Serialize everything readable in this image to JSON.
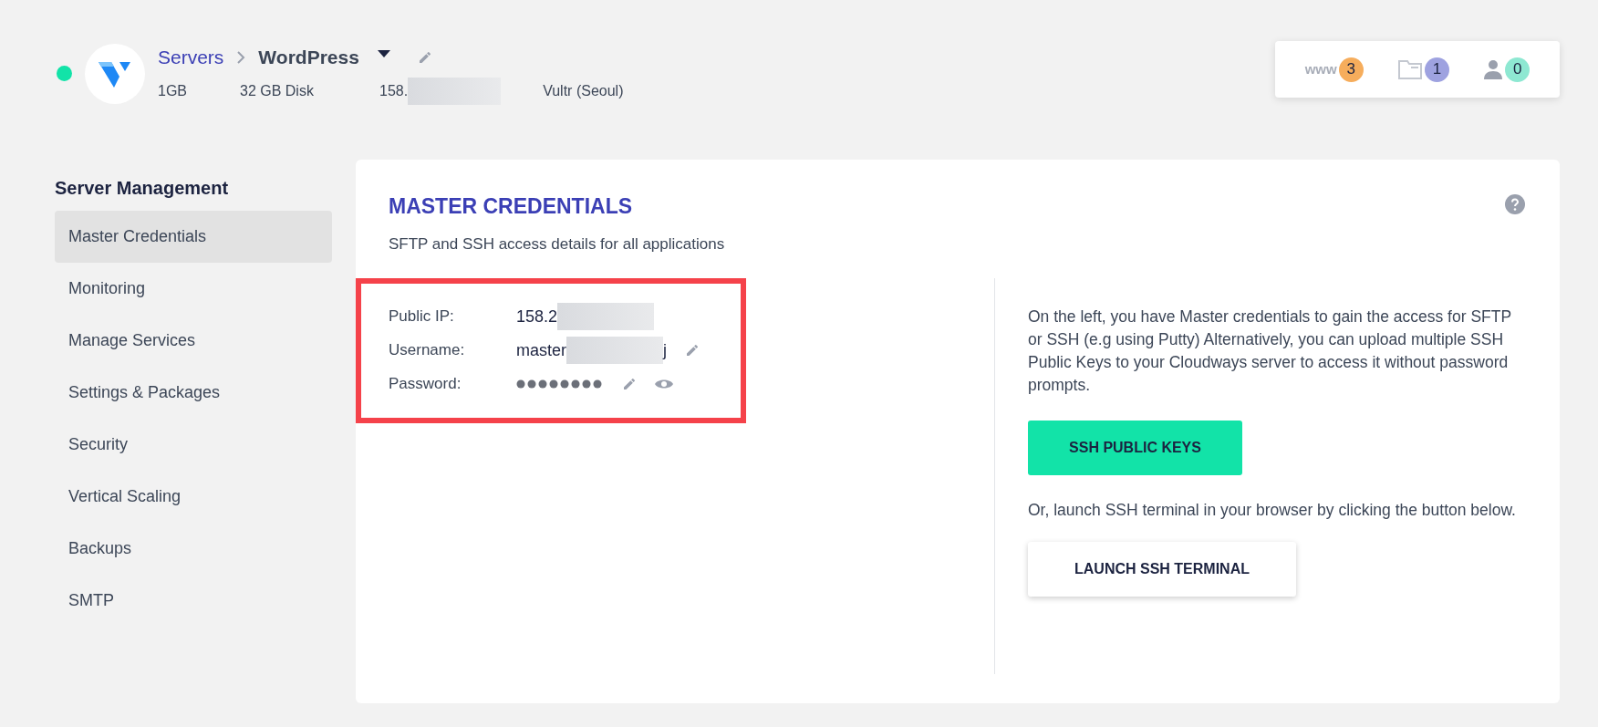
{
  "server": {
    "online": true,
    "breadcrumb": "Servers",
    "name": "WordPress",
    "ram": "1GB",
    "disk": "32 GB Disk",
    "ip_start": "158.",
    "provider": "Vultr (Seoul)"
  },
  "counters": [
    {
      "kind": "www",
      "label": "www",
      "count": "3",
      "color": "#f6ad5c"
    },
    {
      "kind": "folder",
      "count": "1",
      "color": "#9ea2e0"
    },
    {
      "kind": "user",
      "count": "0",
      "color": "#8ee8d2"
    }
  ],
  "sidebar": {
    "heading": "Server Management",
    "items": [
      {
        "label": "Master Credentials",
        "selected": true
      },
      {
        "label": "Monitoring",
        "selected": false
      },
      {
        "label": "Manage Services",
        "selected": false
      },
      {
        "label": "Settings & Packages",
        "selected": false
      },
      {
        "label": "Security",
        "selected": false
      },
      {
        "label": "Vertical Scaling",
        "selected": false
      },
      {
        "label": "Backups",
        "selected": false
      },
      {
        "label": "SMTP",
        "selected": false
      }
    ]
  },
  "panel": {
    "title": "MASTER CREDENTIALS",
    "subtitle": "SFTP and SSH access details for all applications",
    "credentials": [
      {
        "kind": "ip",
        "label": "Public IP:",
        "value_start": "158.2"
      },
      {
        "kind": "username",
        "label": "Username:",
        "value_start": "master",
        "value_end": "j",
        "actions": [
          {
            "kind": "edit"
          }
        ]
      },
      {
        "kind": "password",
        "label": "Password:",
        "actions": [
          {
            "kind": "edit"
          },
          {
            "kind": "reveal"
          }
        ]
      }
    ],
    "info": "On the left, you have Master credentials to gain the access for SFTP or SSH (e.g using Putty) Alternatively, you can upload multiple SSH Public Keys to your Cloudways server to access it without password prompts.",
    "primary_button": "SSH PUBLIC KEYS",
    "terminal_info": "Or, launch SSH terminal in your browser by clicking the button below.",
    "secondary_button": "LAUNCH SSH TERMINAL"
  }
}
